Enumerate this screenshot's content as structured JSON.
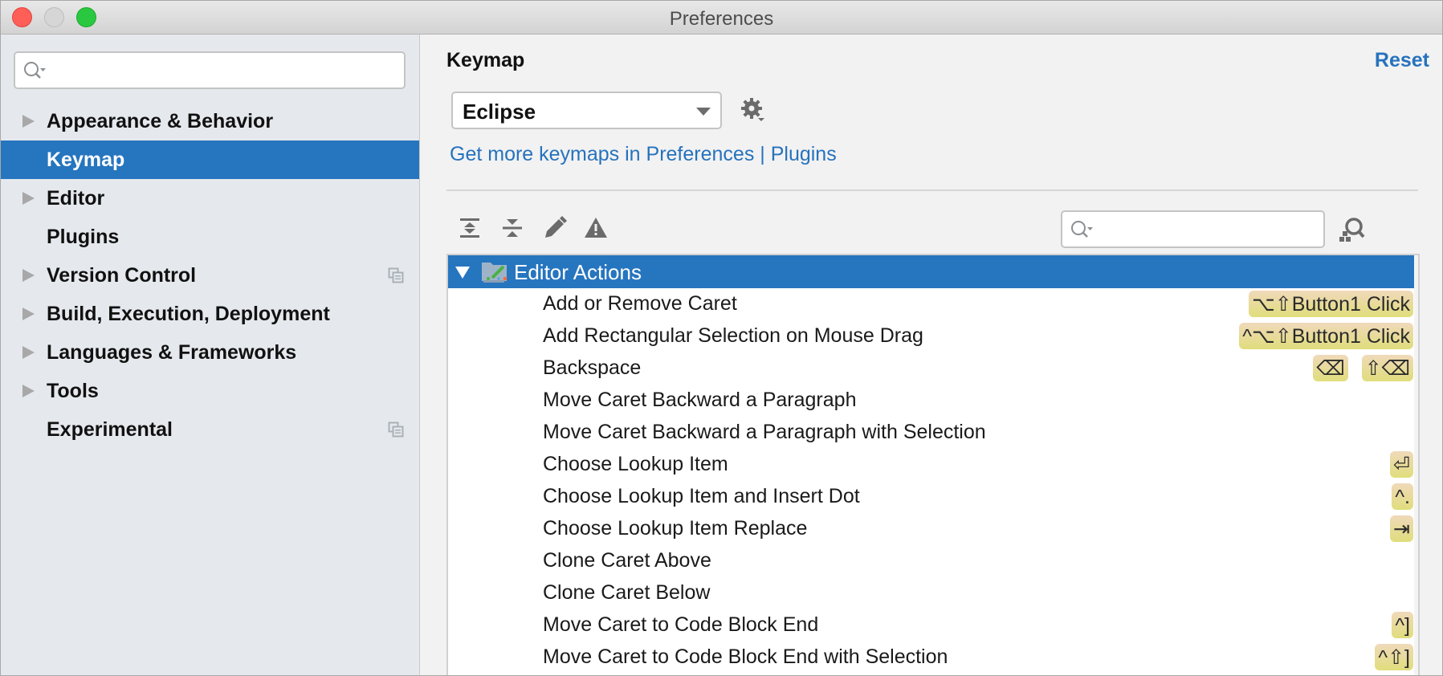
{
  "window": {
    "title": "Preferences",
    "controls": [
      "close",
      "minimize",
      "maximize"
    ]
  },
  "sidebar": {
    "search": {
      "value": "",
      "placeholder": ""
    },
    "items": [
      {
        "label": "Appearance & Behavior",
        "expandable": true,
        "selected": false,
        "copy_icon": false
      },
      {
        "label": "Keymap",
        "expandable": false,
        "selected": true,
        "copy_icon": false
      },
      {
        "label": "Editor",
        "expandable": true,
        "selected": false,
        "copy_icon": false
      },
      {
        "label": "Plugins",
        "expandable": false,
        "selected": false,
        "copy_icon": false
      },
      {
        "label": "Version Control",
        "expandable": true,
        "selected": false,
        "copy_icon": true
      },
      {
        "label": "Build, Execution, Deployment",
        "expandable": true,
        "selected": false,
        "copy_icon": false
      },
      {
        "label": "Languages & Frameworks",
        "expandable": true,
        "selected": false,
        "copy_icon": false
      },
      {
        "label": "Tools",
        "expandable": true,
        "selected": false,
        "copy_icon": false
      },
      {
        "label": "Experimental",
        "expandable": false,
        "selected": false,
        "copy_icon": true
      }
    ]
  },
  "main": {
    "title": "Keymap",
    "reset_label": "Reset",
    "keymap_select": {
      "value": "Eclipse"
    },
    "link": {
      "prefix": "Get more keymaps in Preferences",
      "separator": " | ",
      "target": "Plugins"
    },
    "toolbar": {
      "icons": [
        "expand-all-icon",
        "collapse-all-icon",
        "edit-icon",
        "conflicts-warning-icon"
      ],
      "search": {
        "value": "",
        "placeholder": ""
      },
      "find_shortcut_icon": "find-by-shortcut-icon"
    },
    "tree": {
      "group": {
        "label": "Editor Actions",
        "expanded": true,
        "selected": true
      },
      "rows": [
        {
          "label": "Add or Remove Caret",
          "shortcuts": [
            "⌥⇧Button1 Click"
          ]
        },
        {
          "label": "Add Rectangular Selection on Mouse Drag",
          "shortcuts": [
            "^⌥⇧Button1 Click"
          ]
        },
        {
          "label": "Backspace",
          "shortcuts": [
            "⌫",
            "⇧⌫"
          ]
        },
        {
          "label": "Move Caret Backward a Paragraph",
          "shortcuts": []
        },
        {
          "label": "Move Caret Backward a Paragraph with Selection",
          "shortcuts": []
        },
        {
          "label": "Choose Lookup Item",
          "shortcuts": [
            "⏎"
          ]
        },
        {
          "label": "Choose Lookup Item and Insert Dot",
          "shortcuts": [
            "^."
          ]
        },
        {
          "label": "Choose Lookup Item Replace",
          "shortcuts": [
            "⇥"
          ]
        },
        {
          "label": "Clone Caret Above",
          "shortcuts": []
        },
        {
          "label": "Clone Caret Below",
          "shortcuts": []
        },
        {
          "label": "Move Caret to Code Block End",
          "shortcuts": [
            "^]"
          ]
        },
        {
          "label": "Move Caret to Code Block End with Selection",
          "shortcuts": [
            "^⇧]"
          ]
        }
      ]
    }
  },
  "colors": {
    "accent": "#2675bf",
    "link": "#2672bd",
    "sidebar_bg": "#e5e9ed",
    "shortcut_badge_top": "#f0d9bb",
    "shortcut_badge_bottom": "#e0dd7b"
  }
}
